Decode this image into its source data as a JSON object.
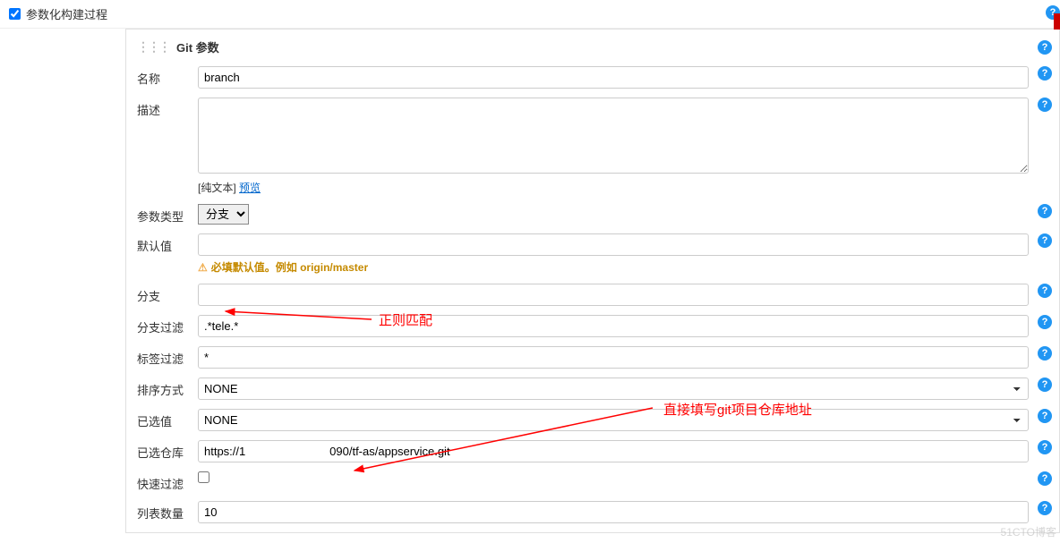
{
  "top": {
    "checkbox_label": "参数化构建过程"
  },
  "block": {
    "title": "Git 参数"
  },
  "fields": {
    "name": {
      "label": "名称",
      "value": "branch"
    },
    "description": {
      "label": "描述",
      "subtext_prefix": "[纯文本] ",
      "subtext_link": "预览"
    },
    "param_type": {
      "label": "参数类型",
      "selected": "分支"
    },
    "default_value": {
      "label": "默认值",
      "value": "",
      "warning": "必填默认值。例如 origin/master"
    },
    "branch": {
      "label": "分支",
      "value": ""
    },
    "branch_filter": {
      "label": "分支过滤",
      "value": ".*tele.*"
    },
    "tag_filter": {
      "label": "标签过滤",
      "value": "*"
    },
    "sort_mode": {
      "label": "排序方式",
      "selected": "NONE"
    },
    "selected_value": {
      "label": "已选值",
      "selected": "NONE"
    },
    "selected_repo": {
      "label": "已选仓库",
      "value": "https://1                          090/tf-as/appservice.git"
    },
    "quick_filter": {
      "label": "快速过滤"
    },
    "list_count": {
      "label": "列表数量",
      "value": "10"
    }
  },
  "annotations": {
    "regex": "正则匹配",
    "repo": "直接填写git项目仓库地址"
  },
  "watermark": "51CTO博客"
}
